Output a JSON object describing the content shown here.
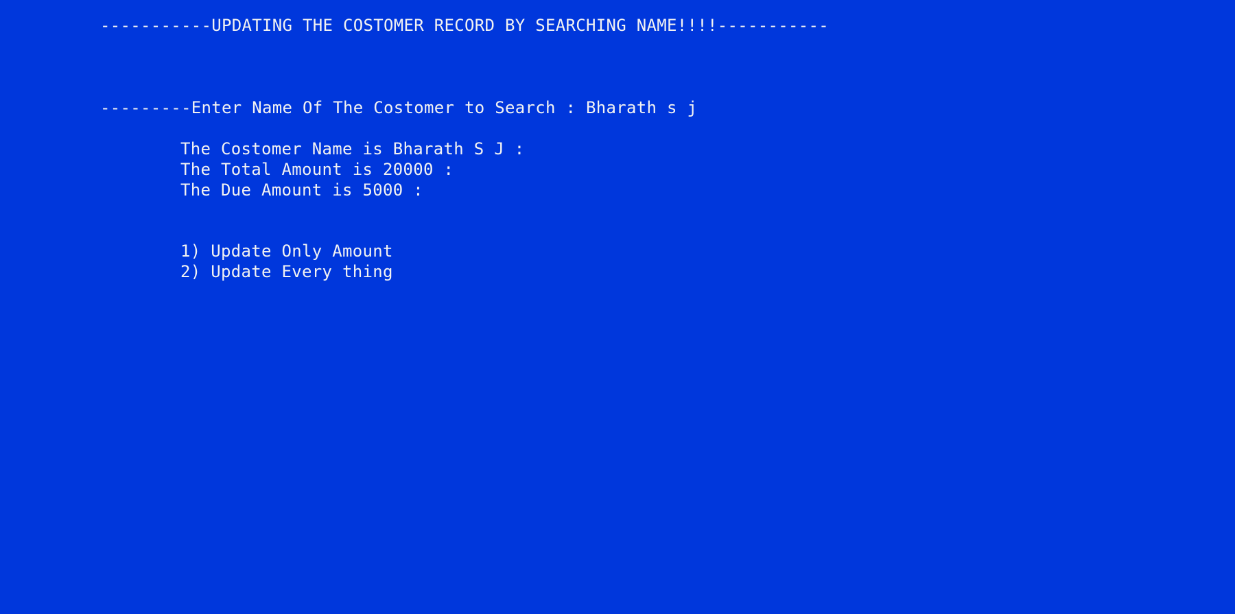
{
  "console": {
    "background_color": "#0037dc",
    "text_color": "#f2f2f2",
    "header": "-----------UPDATING THE COSTOMER RECORD BY SEARCHING NAME!!!!-----------",
    "prompt": {
      "label": "---------Enter Name Of The Costomer to Search : ",
      "input_value": "Bharath s j"
    },
    "record": {
      "name_line": "The Costomer Name is Bharath S J :",
      "total_line": "The Total Amount is 20000 :",
      "due_line": "The Due Amount is 5000 :"
    },
    "menu": {
      "options": [
        "1) Update Only Amount",
        "2) Update Every thing"
      ]
    }
  }
}
